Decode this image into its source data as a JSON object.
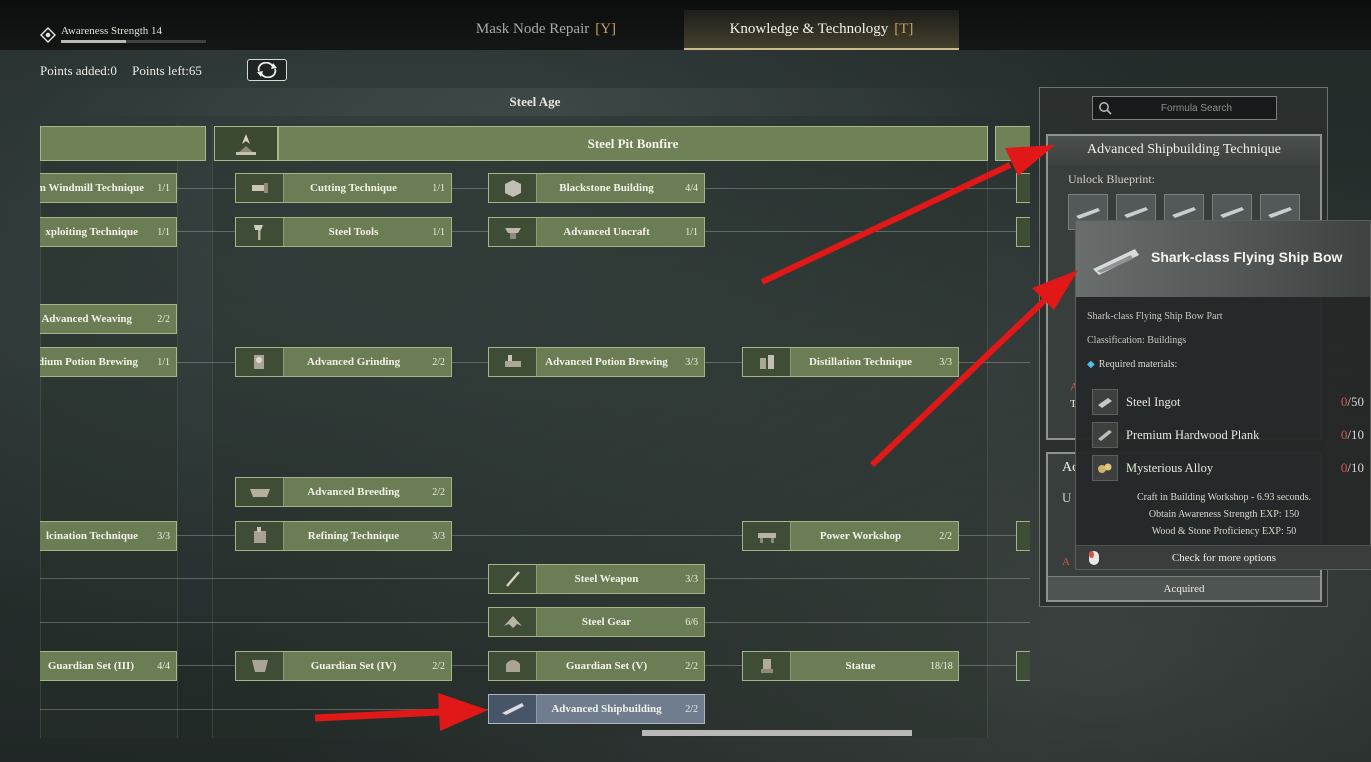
{
  "header": {
    "awareness_label": "Awareness Strength 14",
    "awareness_progress": 0.45,
    "tabs": [
      {
        "label": "Mask Node Repair",
        "hotkey": "[Y]",
        "active": false
      },
      {
        "label": "Knowledge & Technology",
        "hotkey": "[T]",
        "active": true
      }
    ]
  },
  "points": {
    "added": "Points added:0",
    "left": "Points left:65"
  },
  "tree": {
    "age_title": "Steel Age",
    "bonfire": "Steel Pit Bonfire",
    "nodes": [
      {
        "label": "ium Windmill Technique",
        "count": "1/1"
      },
      {
        "label": "xploiting Technique",
        "count": "1/1"
      },
      {
        "label": "Advanced Weaving",
        "count": "2/2"
      },
      {
        "label": "dium Potion Brewing",
        "count": "1/1"
      },
      {
        "label": "lcination Technique",
        "count": "3/3"
      },
      {
        "label": "Guardian Set (III)",
        "count": "4/4"
      },
      {
        "label": "Cutting Technique",
        "count": "1/1"
      },
      {
        "label": "Steel Tools",
        "count": "1/1"
      },
      {
        "label": "Advanced Grinding",
        "count": "2/2"
      },
      {
        "label": "Advanced Breeding",
        "count": "2/2"
      },
      {
        "label": "Refining Technique",
        "count": "3/3"
      },
      {
        "label": "Guardian Set (IV)",
        "count": "2/2"
      },
      {
        "label": "Blackstone Building",
        "count": "4/4"
      },
      {
        "label": "Advanced Uncraft",
        "count": "1/1"
      },
      {
        "label": "Advanced Potion Brewing",
        "count": "3/3"
      },
      {
        "label": "Steel Weapon",
        "count": "3/3"
      },
      {
        "label": "Steel Gear",
        "count": "6/6"
      },
      {
        "label": "Guardian Set (V)",
        "count": "2/2"
      },
      {
        "label": "Advanced Shipbuilding",
        "count": "2/2"
      },
      {
        "label": "Distillation Technique",
        "count": "3/3"
      },
      {
        "label": "Power Workshop",
        "count": "2/2"
      },
      {
        "label": "Statue",
        "count": "18/18"
      }
    ]
  },
  "panel": {
    "search_placeholder": "Formula Search",
    "tech_title": "Advanced Shipbuilding Technique",
    "unlock_label": "Unlock Blueprint:",
    "card2_title": "Ac",
    "card2_letter": "U",
    "acquired_label": "Acquired",
    "peek_a1": "A",
    "peek_t": "T",
    "peek_a2": "A"
  },
  "tooltip": {
    "item_name": "Shark-class Flying Ship Bow",
    "description": "Shark-class Flying Ship Bow Part",
    "classification": "Classification: Buildings",
    "required_label": "Required materials:",
    "materials": [
      {
        "name": "Steel Ingot",
        "have": "0",
        "need": "/50",
        "icon": "ingot-icon"
      },
      {
        "name": "Premium Hardwood Plank",
        "have": "0",
        "need": "/10",
        "icon": "plank-icon"
      },
      {
        "name": "Mysterious Alloy",
        "have": "0",
        "need": "/10",
        "icon": "alloy-icon"
      }
    ],
    "craft_info": "Craft in Building Workshop - 6.93 seconds.",
    "exp_awareness": "Obtain Awareness Strength EXP: 150",
    "exp_wood": "Wood & Stone Proficiency EXP: 50",
    "footer": "Check for more options"
  },
  "colors": {
    "node_green": "#6b7d55",
    "node_selected": "#6f7d8e",
    "tab_accent": "#cfb889",
    "hotkey": "#caa35f",
    "material_missing": "#d4574c",
    "arrow_red": "#e01818"
  }
}
